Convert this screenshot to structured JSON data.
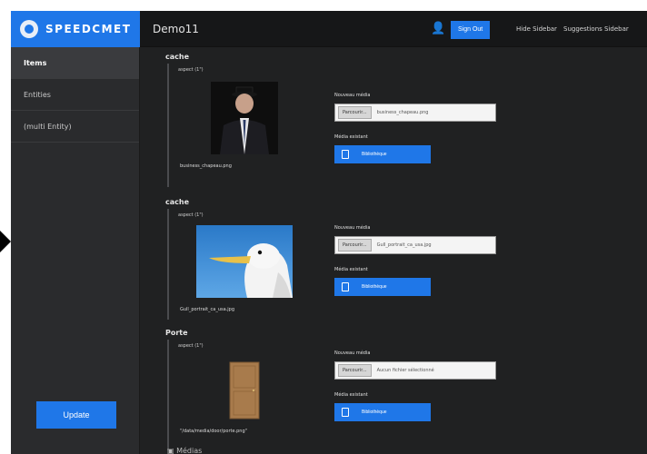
{
  "brand": {
    "name": "SPEEDCMET"
  },
  "app": {
    "title": "Demo11"
  },
  "topbar": {
    "primary_button": "Sign Out",
    "link1": "Hide Sidebar",
    "link2": "Suggestions Sidebar"
  },
  "sidebar": {
    "items": [
      {
        "label": "Items"
      },
      {
        "label": "Entities"
      },
      {
        "label": "(multi Entity)"
      }
    ],
    "update_label": "Update"
  },
  "sections": [
    {
      "title": "cache",
      "sub": "aspect (1\")",
      "caption": "business_chapeau.png",
      "field_label": "Nouveau média",
      "browse_label": "Parcourir...",
      "file_name": "business_chapeau.png",
      "library_label": "Média existant",
      "library_button": "Bibliothèque"
    },
    {
      "title": "cache",
      "sub": "aspect (1\")",
      "caption": "Gull_portrait_ca_usa.jpg",
      "field_label": "Nouveau média",
      "browse_label": "Parcourir...",
      "file_name": "Gull_portrait_ca_usa.jpg",
      "library_label": "Média existant",
      "library_button": "Bibliothèque"
    },
    {
      "title": "Porte",
      "sub": "aspect (1\")",
      "caption": "\"/data/media/door/porte.png\"",
      "field_label": "Nouveau média",
      "browse_label": "Parcourir...",
      "file_name": "Aucun fichier sélectionné",
      "library_label": "Média existant",
      "library_button": "Bibliothèque"
    }
  ],
  "bottom": {
    "label": "Médias"
  },
  "colors": {
    "accent": "#1f77e8",
    "background": "#202122",
    "sidebar": "#2a2b2d"
  }
}
